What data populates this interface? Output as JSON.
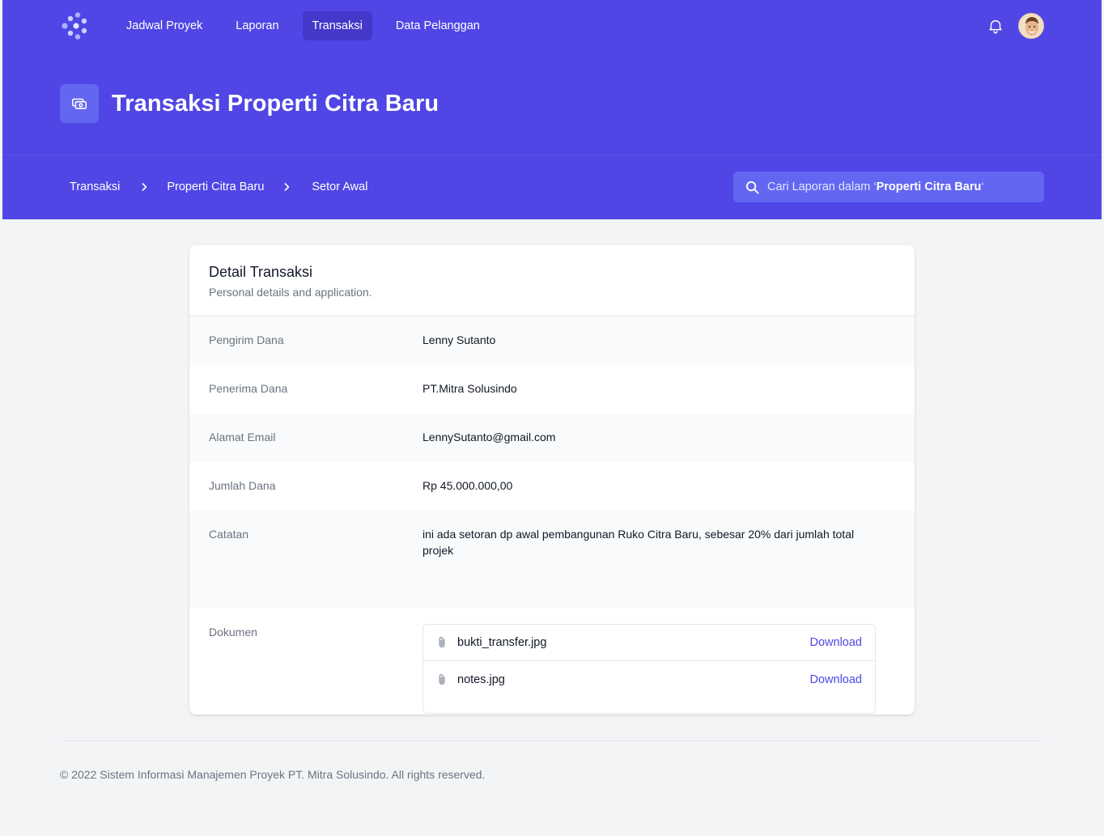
{
  "nav": {
    "logo_icon": "dots-logo-icon",
    "links": [
      {
        "label": "Jadwal Proyek",
        "active": false
      },
      {
        "label": "Laporan",
        "active": false
      },
      {
        "label": "Transaksi",
        "active": true
      },
      {
        "label": "Data Pelanggan",
        "active": false
      }
    ],
    "bell_icon": "bell-icon",
    "avatar_icon": "user-avatar"
  },
  "header": {
    "title": "Transaksi Properti Citra Baru",
    "title_icon": "cash-icon"
  },
  "breadcrumb": [
    "Transaksi",
    "Properti Citra Baru",
    "Setor Awal"
  ],
  "search": {
    "prefix": "Cari Laporan dalam ‘",
    "bold": "Properti Citra Baru",
    "suffix": "‘"
  },
  "card": {
    "title": "Detail Transaksi",
    "subtitle": "Personal details and application.",
    "fields": [
      {
        "label": "Pengirim Dana",
        "value": "Lenny Sutanto"
      },
      {
        "label": "Penerima Dana",
        "value": "PT.Mitra Solusindo"
      },
      {
        "label": "Alamat Email",
        "value": "LennySutanto@gmail.com"
      },
      {
        "label": "Jumlah Dana",
        "value": "Rp 45.000.000,00"
      },
      {
        "label": "Catatan",
        "value": "ini ada setoran dp awal pembangunan Ruko Citra Baru, sebesar 20% dari jumlah total projek"
      }
    ],
    "documents_label": "Dokumen",
    "documents": [
      {
        "name": "bukti_transfer.jpg",
        "action": "Download"
      },
      {
        "name": "notes.jpg",
        "action": "Download"
      }
    ]
  },
  "footer": {
    "text": "© 2022 Sistem Informasi Manajemen Proyek PT. Mitra Solusindo. All rights reserved."
  },
  "colors": {
    "brand": "#4f46e5",
    "brand_dark": "#4338ca",
    "brand_light": "#6366f1",
    "page_bg": "#f3f4f6"
  }
}
